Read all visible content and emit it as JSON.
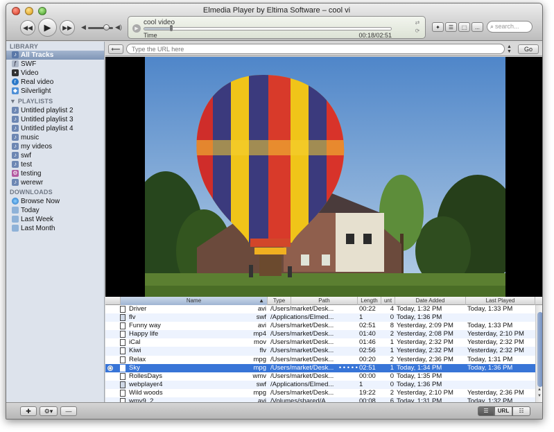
{
  "window": {
    "title": "Elmedia Player by Eltima Software – cool vi"
  },
  "player": {
    "now_playing": "cool video",
    "time_label": "Time",
    "position": "00:18/02:51",
    "progress": 0.105
  },
  "search": {
    "placeholder": "search..."
  },
  "toolbar": {
    "more_label": "..."
  },
  "urlbar": {
    "placeholder": "Type the URL here",
    "go_label": "Go"
  },
  "sidebar": {
    "library_header": "LIBRARY",
    "library": [
      {
        "label": "All Tracks",
        "icon": "music-note-icon",
        "selected": true
      },
      {
        "label": "SWF",
        "icon": "flash-icon"
      },
      {
        "label": "Video",
        "icon": "film-icon"
      },
      {
        "label": "Real video",
        "icon": "realplayer-icon"
      },
      {
        "label": "Silverlight",
        "icon": "silverlight-icon"
      }
    ],
    "playlists_header": "PLAYLISTS",
    "playlists": [
      {
        "label": "Untitled playlist 2"
      },
      {
        "label": "Untitled playlist 3"
      },
      {
        "label": "Untitled playlist 4"
      },
      {
        "label": "music"
      },
      {
        "label": "my videos"
      },
      {
        "label": "swf"
      },
      {
        "label": "test"
      },
      {
        "label": "testing"
      },
      {
        "label": "werewr"
      }
    ],
    "downloads_header": "DOWNLOADS",
    "downloads": [
      {
        "label": "Browse Now",
        "icon": "globe-icon"
      },
      {
        "label": "Today",
        "icon": "folder-icon"
      },
      {
        "label": "Last Week",
        "icon": "folder-icon"
      },
      {
        "label": "Last Month",
        "icon": "folder-icon"
      }
    ]
  },
  "table": {
    "columns": [
      "Name",
      "Type",
      "Path",
      "Length",
      "unt",
      "Date Added",
      "Last Played"
    ],
    "rows": [
      {
        "name": "Driver",
        "type": "avi",
        "path": "/Users/market/Desk...",
        "length": "00:22",
        "count": "4",
        "added": "Today, 1:32 PM",
        "played": "Today, 1:33 PM"
      },
      {
        "name": "flv",
        "type": "swf",
        "path": "/Applications/Elmed...",
        "length": "1",
        "count": "0",
        "added": "Today, 1:36 PM",
        "played": ""
      },
      {
        "name": "Funny way",
        "type": "avi",
        "path": "/Users/market/Desk...",
        "length": "02:51",
        "count": "8",
        "added": "Yesterday, 2:09 PM",
        "played": "Today, 1:33 PM"
      },
      {
        "name": "Happy life",
        "type": "mp4",
        "path": "/Users/market/Desk...",
        "length": "01:40",
        "count": "2",
        "added": "Yesterday, 2:08 PM",
        "played": "Yesterday, 2:10 PM"
      },
      {
        "name": "iCal",
        "type": "mov",
        "path": "/Users/market/Desk...",
        "length": "01:46",
        "count": "1",
        "added": "Yesterday, 2:32 PM",
        "played": "Yesterday, 2:32 PM"
      },
      {
        "name": "Kiwi",
        "type": "flv",
        "path": "/Users/market/Desk...",
        "length": "02:56",
        "count": "1",
        "added": "Yesterday, 2:32 PM",
        "played": "Yesterday, 2:32 PM"
      },
      {
        "name": "Relax",
        "type": "mpg",
        "path": "/Users/market/Desk...",
        "length": "00:20",
        "count": "2",
        "added": "Yesterday, 2:36 PM",
        "played": "Today, 1:31 PM"
      },
      {
        "name": "Sky",
        "type": "mpg",
        "path": "/Users/market/Desk...",
        "length": "02:51",
        "count": "1",
        "added": "Today, 1:34 PM",
        "played": "Today, 1:36 PM",
        "selected": true,
        "rating": "• • • • •"
      },
      {
        "name": "RollesDays",
        "type": "wmv",
        "path": "/Users/market/Desk...",
        "length": "00:00",
        "count": "0",
        "added": "Today, 1:35 PM",
        "played": ""
      },
      {
        "name": "webplayer4",
        "type": "swf",
        "path": "/Applications/Elmed...",
        "length": "1",
        "count": "0",
        "added": "Today, 1:36 PM",
        "played": ""
      },
      {
        "name": "Wild woods",
        "type": "mpg",
        "path": "/Users/market/Desk...",
        "length": "19:22",
        "count": "2",
        "added": "Yesterday, 2:10 PM",
        "played": "Yesterday, 2:36 PM"
      },
      {
        "name": "wmv9_2",
        "type": "avi",
        "path": "/Volumes/shared/A...",
        "length": "00:08",
        "count": "6",
        "added": "Today, 1:31 PM",
        "played": "Today, 1:32 PM"
      }
    ]
  },
  "bottombar": {
    "url_label": "URL"
  }
}
